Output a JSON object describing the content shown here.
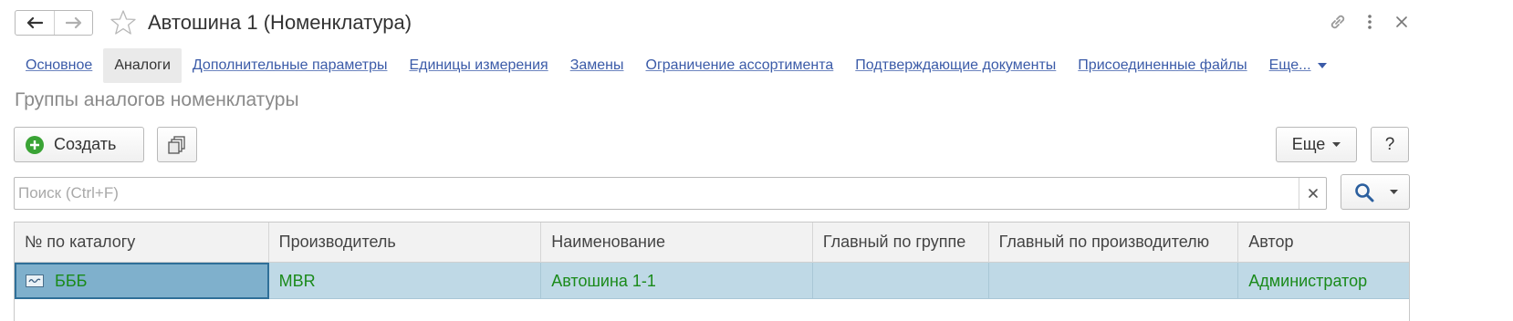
{
  "window": {
    "title": "Автошина 1 (Номенклатура)",
    "icons": [
      "back-arrow-icon",
      "forward-arrow-icon",
      "favorite-star-icon",
      "link-icon",
      "more-vertical-icon",
      "close-icon"
    ]
  },
  "tabs": [
    {
      "label": "Основное",
      "active": false
    },
    {
      "label": "Аналоги",
      "active": true
    },
    {
      "label": "Дополнительные параметры",
      "active": false
    },
    {
      "label": "Единицы измерения",
      "active": false
    },
    {
      "label": "Замены",
      "active": false
    },
    {
      "label": "Ограничение ассортимента",
      "active": false
    },
    {
      "label": "Подтверждающие документы",
      "active": false
    },
    {
      "label": "Присоединенные файлы",
      "active": false
    },
    {
      "label": "Еще...",
      "active": false
    }
  ],
  "section": {
    "title": "Группы аналогов номенклатуры"
  },
  "toolbar": {
    "create_label": "Создать",
    "more_label": "Еще",
    "help_label": "?"
  },
  "search": {
    "placeholder": "Поиск (Ctrl+F)",
    "value": ""
  },
  "table": {
    "columns": [
      "№ по каталогу",
      "Производитель",
      "Наименование",
      "Главный по группе",
      "Главный по производителю",
      "Автор"
    ],
    "rows": [
      [
        "БББ",
        "MBR",
        "Автошина 1-1",
        "",
        "",
        "Администратор"
      ]
    ]
  },
  "colors": {
    "accent_link": "#3b5ba8",
    "row_selected": "#bfd9e6",
    "cell_focused": "#7fb0cc",
    "row_text": "#1a8a1a",
    "create_icon": "#3aa335"
  }
}
